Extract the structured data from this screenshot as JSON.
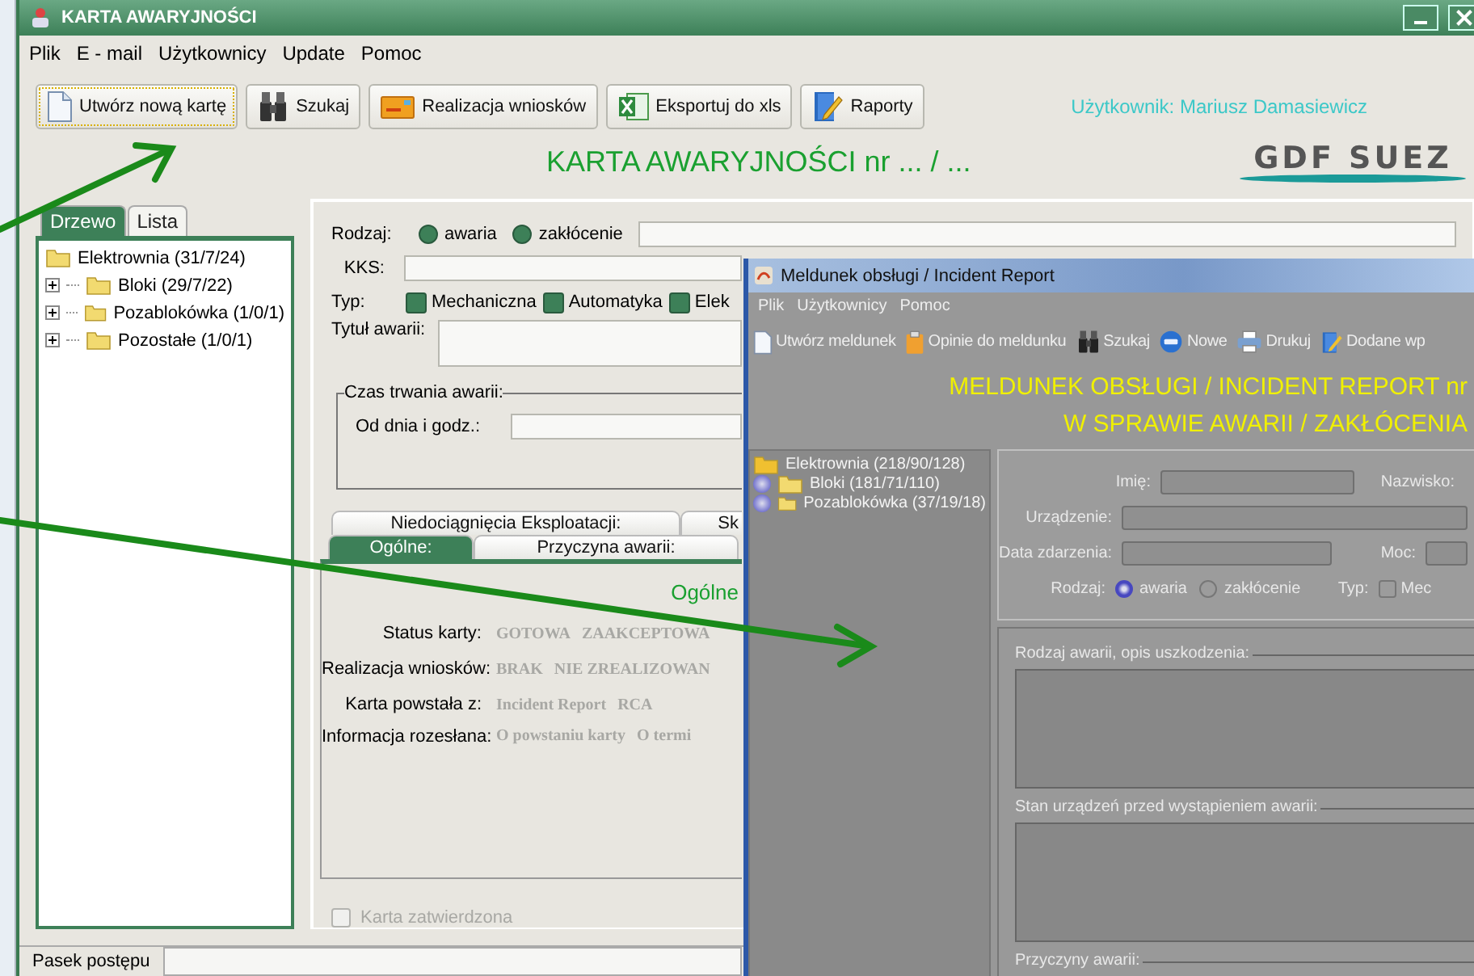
{
  "main_window": {
    "title": "KARTA AWARYJNOŚCI",
    "menu": [
      "Plik",
      "E - mail",
      "Użytkownicy",
      "Update",
      "Pomoc"
    ],
    "toolbar": [
      {
        "label": "Utwórz nową kartę",
        "focused": true
      },
      {
        "label": "Szukaj",
        "focused": false
      },
      {
        "label": "Realizacja wniosków",
        "focused": false
      },
      {
        "label": "Eksportuj do xls",
        "focused": false
      },
      {
        "label": "Raporty",
        "focused": false
      }
    ],
    "user": "Użytkownik: Mariusz Damasiewicz",
    "heading": "KARTA AWARYJNOŚCI nr ... / ...",
    "logo": "GDF SUEZ",
    "side_tabs": [
      {
        "label": "Drzewo",
        "selected": true
      },
      {
        "label": "Lista",
        "selected": false
      }
    ],
    "tree": [
      {
        "label": "Elektrownia (31/7/24)",
        "children": [
          {
            "label": "Bloki (29/7/22)",
            "expanded": false
          },
          {
            "label": "Pozablokówka (1/0/1)",
            "expanded": false
          },
          {
            "label": "Pozostałe (1/0/1)",
            "expanded": false
          }
        ]
      }
    ],
    "form": {
      "rodzaj_label": "Rodzaj:",
      "rodzaj_options": [
        {
          "label": "awaria",
          "selected": false
        },
        {
          "label": "zakłócenie",
          "selected": false
        }
      ],
      "kks_label": "KKS:",
      "typ_label": "Typ:",
      "typ_options": [
        {
          "label": "Mechaniczna",
          "checked": false
        },
        {
          "label": "Automatyka",
          "checked": false
        },
        {
          "label": "Elek",
          "checked": false
        }
      ],
      "title_label": "Tytuł awarii:",
      "duration": {
        "legend": "Czas trwania awarii:",
        "from_label": "Od dnia i godz.:"
      },
      "tabs_back": [
        {
          "label": "Niedociągnięcia Eksploatacji:",
          "selected": false
        },
        {
          "label": "Sk",
          "selected": false
        }
      ],
      "tabs_front": [
        {
          "label": "Ogólne:",
          "selected": true
        },
        {
          "label": "Przyczyna awarii:",
          "selected": false
        }
      ],
      "general": {
        "heading": "Ogólne",
        "rows": [
          {
            "label": "Status karty:",
            "values": [
              "GOTOWA",
              "ZAAKCEPTOWA"
            ]
          },
          {
            "label": "Realizacja wniosków:",
            "values": [
              "BRAK",
              "NIE ZREALIZOWAN"
            ]
          },
          {
            "label": "Karta powstała z:",
            "values": [
              "Incident Report",
              "RCA"
            ]
          },
          {
            "label": "Informacja rozesłana:",
            "values": [
              "O powstaniu karty",
              "O termi"
            ]
          }
        ]
      },
      "approved": {
        "label": "Karta zatwierdzona",
        "checked": false,
        "disabled": true
      }
    },
    "status_bar": {
      "label": "Pasek postępu"
    }
  },
  "report_window": {
    "title": "Meldunek obsługi / Incident Report",
    "menu": [
      "Plik",
      "Użytkownicy",
      "Pomoc"
    ],
    "toolbar": [
      "Utwórz meldunek",
      "Opinie do meldunku",
      "Szukaj",
      "Nowe",
      "Drukuj",
      "Dodane wp"
    ],
    "heading": [
      "MELDUNEK OBSŁUGI / INCIDENT REPORT nr",
      "W SPRAWIE AWARII / ZAKŁÓCENIA"
    ],
    "tree": [
      {
        "label": "Elektrownia (218/90/128)",
        "children": [
          {
            "label": "Bloki (181/71/110)",
            "expanded": false
          },
          {
            "label": "Pozablokówka (37/19/18)",
            "expanded": false
          }
        ]
      }
    ],
    "name_label": "Imię:",
    "surname_label": "Nazwisko:",
    "device_label": "Urządzenie:",
    "date_label": "Data zdarzenia:",
    "power_label": "Moc:",
    "rodzaj_label": "Rodzaj:",
    "rodzaj_options": [
      {
        "label": "awaria",
        "selected": true
      },
      {
        "label": "zakłócenie",
        "selected": false
      }
    ],
    "typ_label": "Typ:",
    "typ_options": [
      {
        "label": "Mec",
        "checked": false
      }
    ],
    "sections": [
      "Rodzaj awarii, opis uszkodzenia:",
      "Stan urządzeń przed wystąpieniem awarii:",
      "Przyczyny awarii:"
    ]
  }
}
